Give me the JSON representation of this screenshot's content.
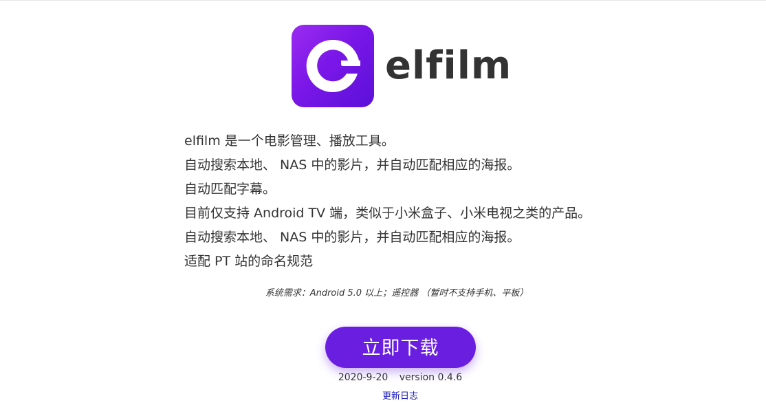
{
  "app": {
    "name": "elfilm"
  },
  "description": {
    "lines": [
      "elfilm 是一个电影管理、播放工具。",
      "自动搜索本地、 NAS 中的影片，并自动匹配相应的海报。",
      "自动匹配字幕。",
      "目前仅支持 Android TV 端，类似于小米盒子、小米电视之类的产品。",
      "自动搜索本地、 NAS 中的影片，并自动匹配相应的海报。",
      "适配 PT 站的命名规范"
    ]
  },
  "requirements": "系统需求：Android 5.0 以上；遥控器 （暂时不支持手机、平板）",
  "download": {
    "label": "立即下载"
  },
  "release": {
    "date": "2020-9-20",
    "version": "version 0.4.6"
  },
  "changelog_link": "更新日志",
  "colors": {
    "brand_purple": "#6a1fe0",
    "link_blue": "#1b1bb8",
    "text": "#333333"
  },
  "icons": {
    "app_icon": "elfilm-play-logo-icon"
  }
}
